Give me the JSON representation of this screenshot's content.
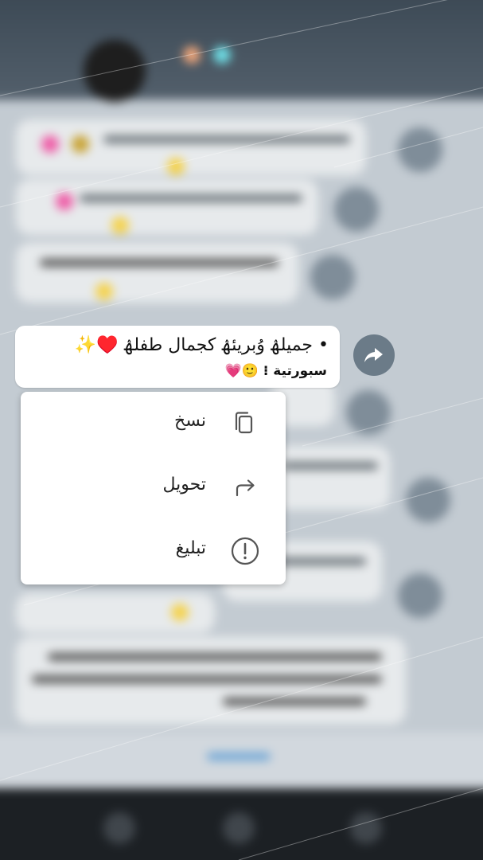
{
  "message": {
    "text": "• جميلۿ وُبريئۿ كجمال طفلۿ",
    "emoji_suffix": "♥️✨",
    "author": "سبورتية",
    "author_emoji": "🙂💗"
  },
  "context_menu": {
    "items": [
      {
        "label": "نسخ",
        "icon": "copy-icon"
      },
      {
        "label": "تحويل",
        "icon": "forward-arrow-icon"
      },
      {
        "label": "تبليغ",
        "icon": "report-icon"
      }
    ]
  },
  "colors": {
    "menu_bg": "#ffffff",
    "bubble_bg": "#ffffff",
    "share_button": "#6b7b88",
    "heart": "#d8232a"
  }
}
